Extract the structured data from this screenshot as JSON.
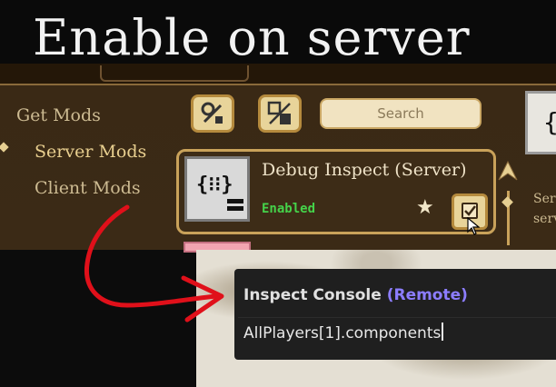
{
  "title": "Enable on server",
  "colors": {
    "panel": "#3b2a16",
    "gold": "#c9a25a",
    "enabled_green": "#45d24a",
    "remote_purple": "#8c7dff",
    "arrow_red": "#e0101a"
  },
  "sidebar": {
    "items": [
      {
        "label": "Get Mods",
        "active": false
      },
      {
        "label": "Server Mods",
        "active": true
      },
      {
        "label": "Client Mods",
        "active": false
      }
    ]
  },
  "toolbar": {
    "search": {
      "placeholder": "Search"
    },
    "icons": [
      "tools-icon",
      "toggle-all-icon"
    ]
  },
  "mod": {
    "name": "Debug Inspect (Server)",
    "status": "Enabled",
    "icon": "{⁝⁝}"
  },
  "right_card": {
    "glyph": "{",
    "snippet_lines": [
      "Ser",
      "serv"
    ]
  },
  "console": {
    "title": "Inspect Console",
    "mode": "(Remote)",
    "input_value": "AllPlayers[1].components"
  }
}
